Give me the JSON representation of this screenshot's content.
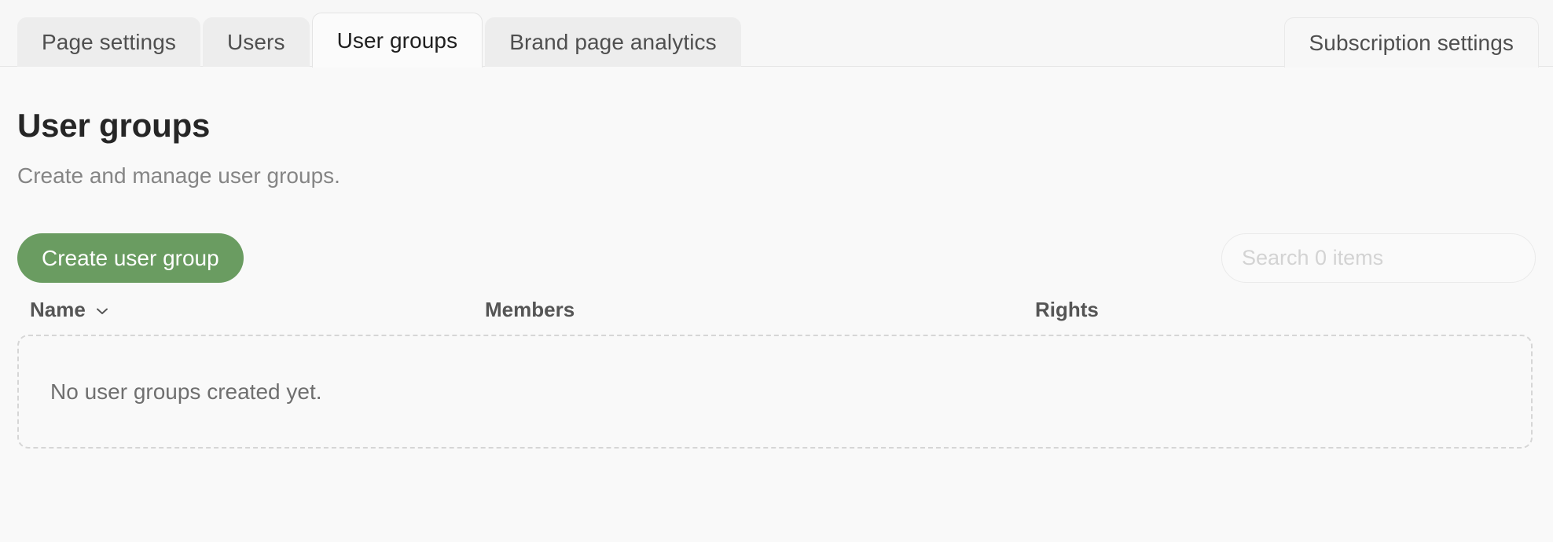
{
  "tabs": {
    "left": [
      {
        "label": "Page settings",
        "active": false
      },
      {
        "label": "Users",
        "active": false
      },
      {
        "label": "User groups",
        "active": true
      },
      {
        "label": "Brand page analytics",
        "active": false
      }
    ],
    "right": [
      {
        "label": "Subscription settings",
        "active": false
      }
    ]
  },
  "header": {
    "title": "User groups",
    "subtitle": "Create and manage user groups."
  },
  "actions": {
    "create_label": "Create user group",
    "create_color": "#6a9c61"
  },
  "search": {
    "placeholder": "Search 0 items",
    "value": ""
  },
  "table": {
    "columns": [
      {
        "label": "Name",
        "sort_icon": "chevron-down-icon"
      },
      {
        "label": "Members",
        "sort_icon": ""
      },
      {
        "label": "Rights",
        "sort_icon": ""
      }
    ],
    "rows": [],
    "empty_message": "No user groups created yet."
  }
}
